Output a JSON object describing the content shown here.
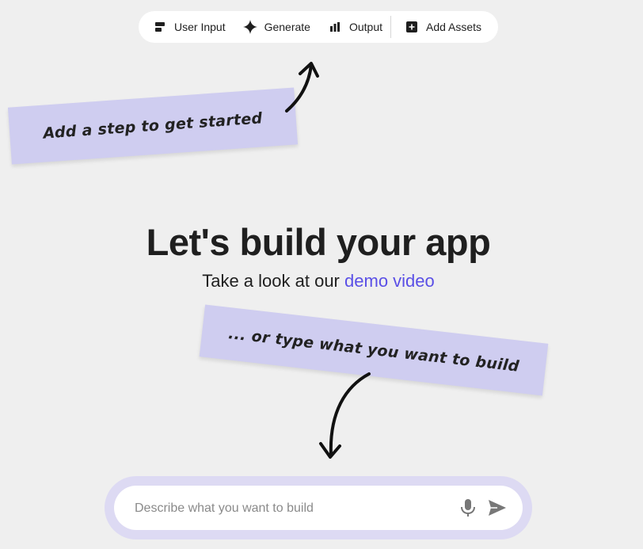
{
  "toolbar": {
    "items": [
      {
        "label": "User Input",
        "icon": "user-input-icon"
      },
      {
        "label": "Generate",
        "icon": "sparkle-icon"
      },
      {
        "label": "Output",
        "icon": "output-icon"
      },
      {
        "label": "Add Assets",
        "icon": "add-box-icon"
      }
    ]
  },
  "notes": {
    "step": "Add a step to get started",
    "type": "... or type what you want to build"
  },
  "hero": {
    "title": "Let's build your app",
    "subtitle_prefix": "Take a look at our",
    "demo_link": "demo video"
  },
  "composer": {
    "placeholder": "Describe what you want to build",
    "value": "",
    "mic_icon": "microphone-icon",
    "send_icon": "send-icon"
  },
  "colors": {
    "background": "#efefef",
    "note": "#cfcdf0",
    "link": "#5a4fe6",
    "composer_ring": "#dddaf3"
  }
}
